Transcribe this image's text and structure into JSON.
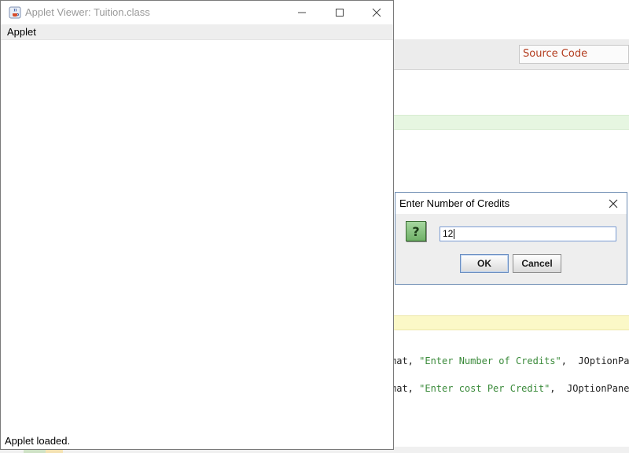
{
  "ide": {
    "source_code_label": "Source Code",
    "code_line_1_prefix": "mat, ",
    "code_line_1_string": "\"Enter Number of Credits\"",
    "code_line_1_suffix": ",  JOptionPan",
    "code_line_2_prefix": "mat, ",
    "code_line_2_string": "\"Enter cost Per Credit\"",
    "code_line_2_suffix": ",  JOptionPane."
  },
  "applet_window": {
    "title": "Applet Viewer: Tuition.class",
    "icon": "java-cup-icon",
    "menu_label": "Applet",
    "status": "Applet loaded."
  },
  "dialog": {
    "title": "Enter Number of Credits",
    "icon": "question-icon",
    "question_glyph": "?",
    "input_value": "12",
    "ok_label": "OK",
    "cancel_label": "Cancel"
  },
  "colors": {
    "source_code_text": "#b33c1e",
    "string_literal": "#3a8a3a",
    "question_icon_bg": "#8cc585"
  }
}
